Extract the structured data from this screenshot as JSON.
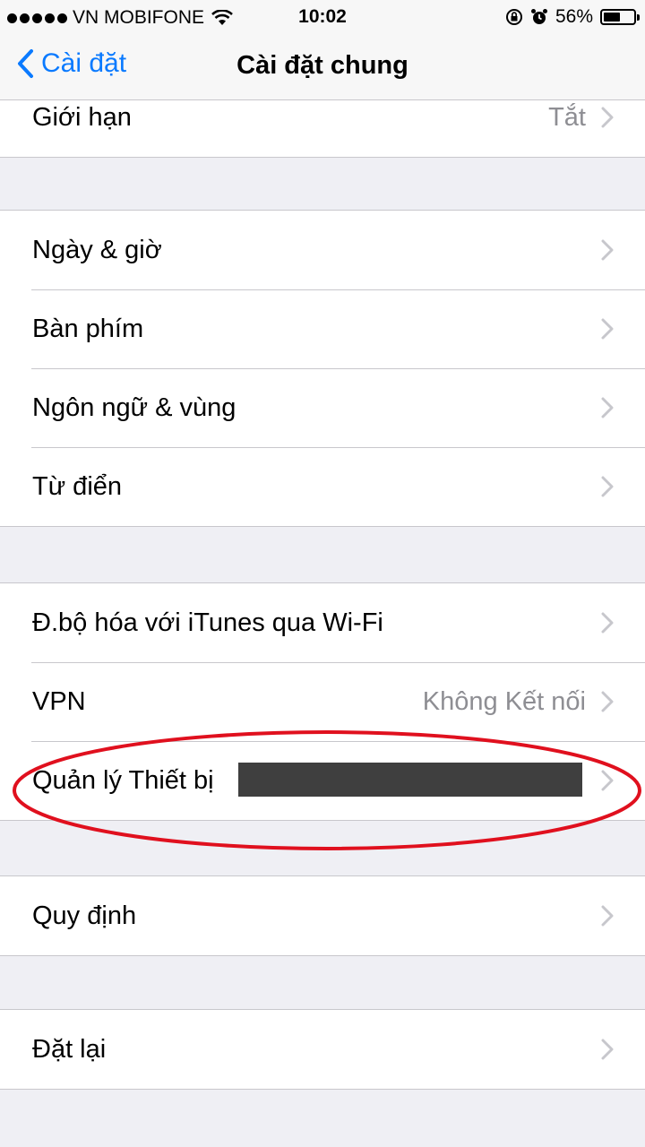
{
  "status_bar": {
    "carrier": "VN MOBIFONE",
    "time": "10:02",
    "battery": "56%",
    "battery_level": 0.56
  },
  "nav": {
    "back_label": "Cài đặt",
    "title": "Cài đặt chung"
  },
  "rows": {
    "restrictions": {
      "label": "Giới hạn",
      "value": "Tắt"
    },
    "date_time": {
      "label": "Ngày & giờ"
    },
    "keyboard": {
      "label": "Bàn phím"
    },
    "language_region": {
      "label": "Ngôn ngữ & vùng"
    },
    "dictionary": {
      "label": "Từ điển"
    },
    "itunes_wifi_sync": {
      "label": "Đ.bộ hóa với iTunes qua Wi-Fi"
    },
    "vpn": {
      "label": "VPN",
      "value": "Không Kết nối"
    },
    "device_management": {
      "label": "Quản lý Thiết bị"
    },
    "regulatory": {
      "label": "Quy định"
    },
    "reset": {
      "label": "Đặt lại"
    }
  },
  "annotation": {
    "shape": "ellipse",
    "color": "#e0101e"
  },
  "colors": {
    "accent": "#0a7aff",
    "background": "#efeff4",
    "secondary_text": "#8e8e93"
  }
}
